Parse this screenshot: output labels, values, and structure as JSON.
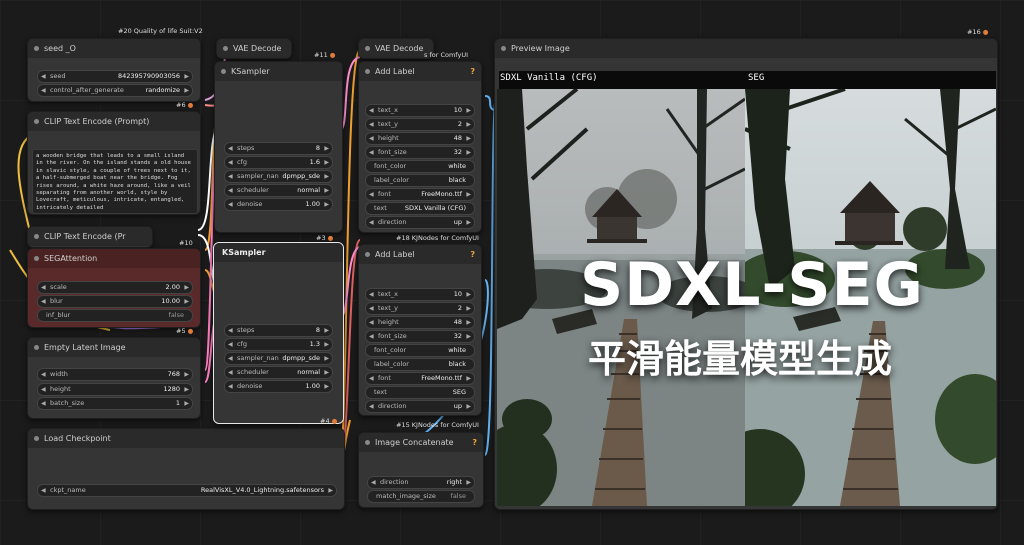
{
  "group_title": "#20 Quality of life Suit:V2",
  "seed_node": {
    "title": "seed _O",
    "seed_label": "seed",
    "seed_value": "842395790903056",
    "control_label": "control_after_generate",
    "control_value": "randomize",
    "id": "#6"
  },
  "clip_pos": {
    "title": "CLIP Text Encode (Prompt)",
    "text": "a wooden bridge that leads to a small island in the river. On the island stands a old house in slavic style, a couple of trees next to it, a half-submerged boat near the bridge. Fog rises around, a white haze around, like a veil separating from another world, style by Lovecraft, meticulous, intricate, entangled, intricately detailed"
  },
  "clip_neg": {
    "title": "CLIP Text Encode (Pr",
    "id": "#10"
  },
  "seg": {
    "title": "SEGAttention",
    "scale_label": "scale",
    "scale_value": "2.00",
    "blur_label": "blur",
    "blur_value": "10.00",
    "inf_label": "inf_blur",
    "inf_value": "false",
    "id": "#5"
  },
  "latent": {
    "title": "Empty Latent Image",
    "width_label": "width",
    "width_value": "768",
    "height_label": "height",
    "height_value": "1280",
    "batch_label": "batch_size",
    "batch_value": "1"
  },
  "ckpt": {
    "title": "Load Checkpoint",
    "label": "ckpt_name",
    "value": "RealVisXL_V4.0_Lightning.safetensors"
  },
  "vae1": {
    "title": "VAE Decode",
    "id": "#11"
  },
  "vae2": {
    "title": "VAE Decode",
    "tag": "s for ComfyUI"
  },
  "ks1": {
    "title": "KSampler",
    "steps_label": "steps",
    "steps": "8",
    "cfg_label": "cfg",
    "cfg": "1.6",
    "sampler_label": "sampler_nan",
    "sampler": "dpmpp_sde",
    "scheduler_label": "scheduler",
    "scheduler": "normal",
    "denoise_label": "denoise",
    "denoise": "1.00",
    "id": "#3"
  },
  "ks2": {
    "title": "KSampler",
    "steps_label": "steps",
    "steps": "8",
    "cfg_label": "cfg",
    "cfg": "1.3",
    "sampler_label": "sampler_nan",
    "sampler": "dpmpp_sde",
    "scheduler_label": "scheduler",
    "scheduler": "normal",
    "denoise_label": "denoise",
    "denoise": "1.00",
    "id": "#4"
  },
  "label1": {
    "title": "Add Label",
    "q": "?",
    "text_x_label": "text_x",
    "text_x": "10",
    "text_y_label": "text_y",
    "text_y": "2",
    "height_label": "height",
    "height": "48",
    "font_size_label": "font_size",
    "font_size": "32",
    "font_color_label": "font_color",
    "font_color": "white",
    "label_color_label": "label_color",
    "label_color": "black",
    "font_label": "font",
    "font": "FreeMono.ttf",
    "text_label": "text",
    "text": "SDXL Vanilla (CFG)",
    "direction_label": "direction",
    "direction": "up",
    "id": "#18 KJNodes for ComfyUI"
  },
  "label2": {
    "title": "Add Label",
    "q": "?",
    "text_x_label": "text_x",
    "text_x": "10",
    "text_y_label": "text_y",
    "text_y": "2",
    "height_label": "height",
    "height": "48",
    "font_size_label": "font_size",
    "font_size": "32",
    "font_color_label": "font_color",
    "font_color": "white",
    "label_color_label": "label_color",
    "label_color": "black",
    "font_label": "font",
    "font": "FreeMono.ttf",
    "text_label": "text",
    "text": "SEG",
    "direction_label": "direction",
    "direction": "up",
    "id": "#15 KJNodes for ComfyUI"
  },
  "concat": {
    "title": "Image Concatenate",
    "q": "?",
    "direction_label": "direction",
    "direction": "right",
    "match_label": "match_image_size",
    "match": "false"
  },
  "preview": {
    "title": "Preview Image",
    "id": "#16",
    "left_label": "SDXL Vanilla (CFG)",
    "right_label": "SEG"
  },
  "overlay": {
    "line1": "SDXL-SEG",
    "line2": "平滑能量模型生成"
  },
  "colors": {
    "node_bg": "#353535",
    "title_bg": "#2a2a2a",
    "seg_bg": "#5a2a2a",
    "accent": "#e9a53a"
  }
}
